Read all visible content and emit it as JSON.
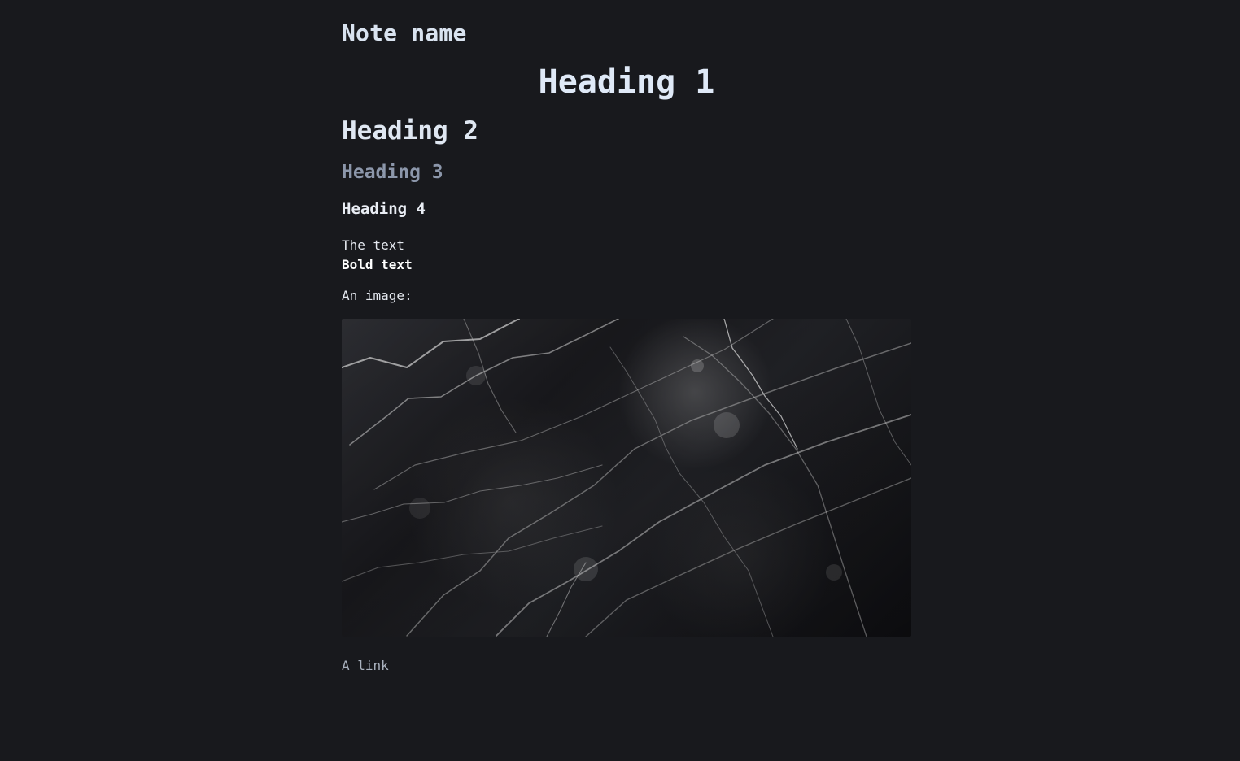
{
  "note": {
    "title": "Note name"
  },
  "content": {
    "heading_1": "Heading 1",
    "heading_2": "Heading 2",
    "heading_3": "Heading 3",
    "heading_4": "Heading 4",
    "text": "The text",
    "bold_text": "Bold text",
    "image_label": "An image:",
    "link_text": "A link"
  },
  "colors": {
    "background": "#18191d",
    "heading": "#dfe9f7",
    "heading_3": "#8c97ab",
    "link": "#a9b1be"
  }
}
